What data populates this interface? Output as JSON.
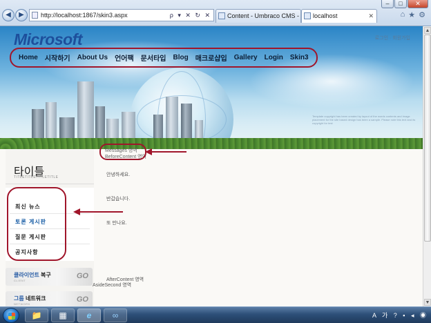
{
  "browser": {
    "url": "http://localhost:1867/skin3.aspx",
    "address_icons": "ρ ▾ ✕ ↻ ✕",
    "tabs": [
      {
        "label": "Content - Umbraco CMS - lo..."
      },
      {
        "label": "localhost"
      }
    ],
    "window_buttons": {
      "minimize": "–",
      "maximize": "□",
      "close": "✕"
    },
    "back_label": "◀",
    "forward_label": "▶",
    "tools": [
      "⌂",
      "★",
      "⚙"
    ]
  },
  "header": {
    "logo": "Microsoft",
    "top_links": "로그인 · 회원가입",
    "fine_print": "Template copyright has been created by layout of the words contents and image placement for the site based design has been a sample. Please note this text and its copyright for test",
    "menu": [
      "Home",
      "시작하기",
      "About Us",
      "언어팩",
      "문서타입",
      "Blog",
      "매크로샵입",
      "Gallery",
      "Login",
      "Skin3"
    ]
  },
  "sidebar": {
    "title": "타이틀",
    "subtitle": "TITLETITLETITLETITLE",
    "items": [
      {
        "label": "최신 뉴스",
        "selected": false
      },
      {
        "label": "토론 게시판",
        "selected": true
      },
      {
        "label": "질문 게시판",
        "selected": false
      },
      {
        "label": "공지사항",
        "selected": false
      }
    ],
    "banners": [
      {
        "title_blue": "클라이언트",
        "title_black": " 복구",
        "sub": "CLIENT",
        "go": "GO"
      },
      {
        "title_blue": "그룹 ",
        "title_black": "네트워크",
        "sub": "NETWORK",
        "go": "GO"
      }
    ]
  },
  "main": {
    "messages_label": "Messages 영역",
    "before_content_label": "BeforeContent 영역",
    "paragraphs": [
      "안녕하세요.",
      "반갑습니다.",
      "또 만나요."
    ],
    "after_content_label": "AfterContent 영역",
    "aside_second_label": "AsideSecond 영역"
  },
  "scrollbar": {
    "up": "▲",
    "down": "▼"
  },
  "taskbar": {
    "buttons": [
      "📁",
      "▦",
      "e",
      "∞"
    ],
    "tray": "A 가 ? ▪ ◂ ◉"
  },
  "colors": {
    "annotation": "#a0152a",
    "menu_text": "#0c1e36",
    "logo": "#1d4f9c",
    "selected_item": "#1b5fa6"
  }
}
